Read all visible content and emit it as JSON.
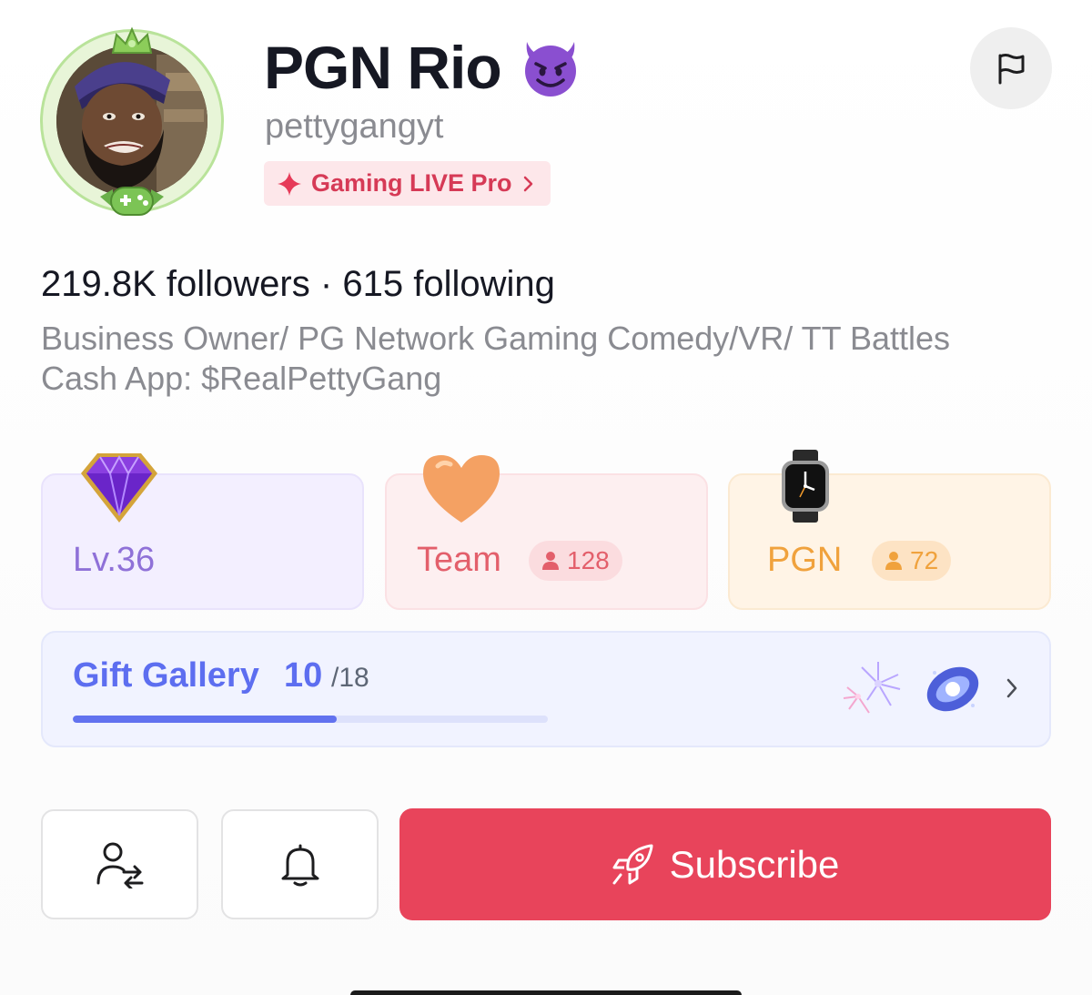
{
  "profile": {
    "display_name": "PGN Rio",
    "name_emoji_icon": "smiling-devil-icon",
    "username": "pettygangyt",
    "live_badge": "Gaming LIVE Pro",
    "followers": "219.8K",
    "followers_label": "followers",
    "separator": "·",
    "following": "615",
    "following_label": "following",
    "bio_line1": "Business Owner/ PG Network Gaming Comedy/VR/ TT Battles",
    "bio_line2": "Cash App: $RealPettyGang"
  },
  "cards": {
    "level": {
      "label": "Lv.36",
      "icon": "purple-diamond-icon"
    },
    "team": {
      "label": "Team",
      "count": "128",
      "icon": "orange-heart-icon"
    },
    "pgn": {
      "label": "PGN",
      "count": "72",
      "icon": "watch-icon"
    }
  },
  "gift_gallery": {
    "title": "Gift Gallery",
    "collected": "10",
    "total": "/18",
    "progress_fraction": 0.556
  },
  "buttons": {
    "subscribe": "Subscribe"
  },
  "colors": {
    "accent_red": "#e8445b",
    "live_pink": "#d63a56",
    "level_purple": "#8f71d8",
    "team_red": "#e35f6b",
    "pgn_orange": "#f0a23d",
    "gallery_blue": "#5d6ef0"
  }
}
